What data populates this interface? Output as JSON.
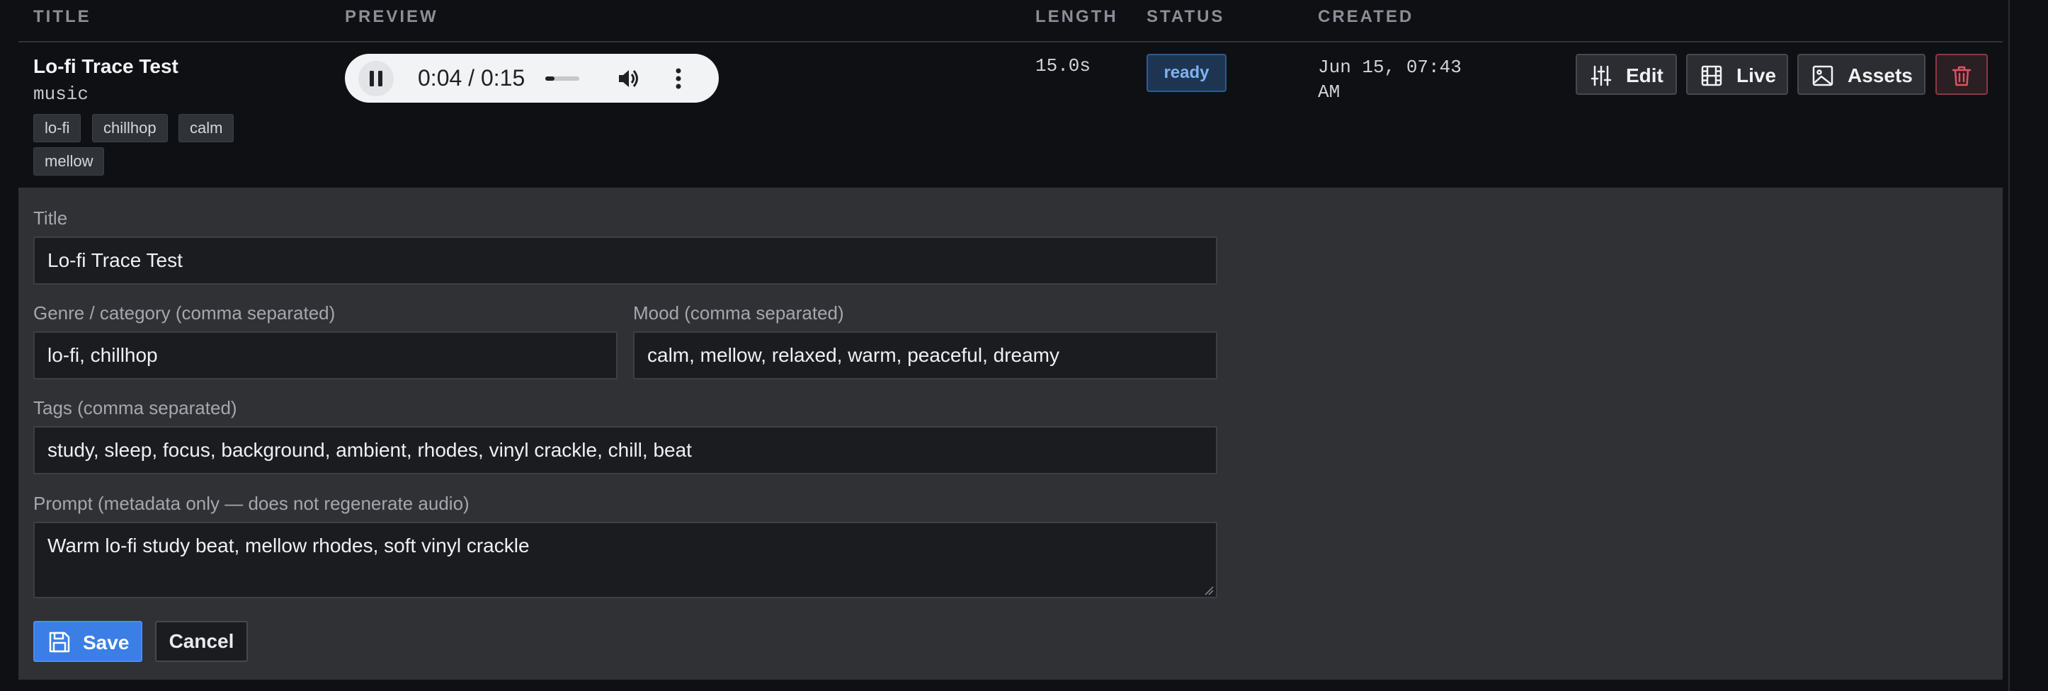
{
  "table": {
    "headers": {
      "title": "TITLE",
      "preview": "PREVIEW",
      "length": "LENGTH",
      "status": "STATUS",
      "created": "CREATED"
    }
  },
  "track": {
    "title": "Lo-fi Trace Test",
    "category": "music",
    "tags": [
      "lo-fi",
      "chillhop",
      "calm",
      "mellow"
    ],
    "length": "15.0s",
    "status": "ready",
    "created": "Jun 15, 07:43 AM"
  },
  "player": {
    "time": "0:04 / 0:15",
    "progress_fraction": 0.267,
    "icons": [
      "pause-icon",
      "volume-icon",
      "more-options-icon"
    ]
  },
  "actions": {
    "edit_label": "Edit",
    "live_label": "Live",
    "assets_label": "Assets",
    "icons": [
      "sliders-icon",
      "film-icon",
      "image-icon",
      "trash-icon"
    ]
  },
  "form": {
    "title_label": "Title",
    "title_value": "Lo-fi Trace Test",
    "genre_label": "Genre / category (comma separated)",
    "genre_value": "lo-fi, chillhop",
    "mood_label": "Mood (comma separated)",
    "mood_value": "calm, mellow, relaxed, warm, peaceful, dreamy",
    "tags_label": "Tags (comma separated)",
    "tags_value": "study, sleep, focus, background, ambient, rhodes, vinyl crackle, chill, beat",
    "prompt_label": "Prompt (metadata only — does not regenerate audio)",
    "prompt_value": "Warm lo-fi study beat, mellow rhodes, soft vinyl crackle",
    "save_label": "Save",
    "cancel_label": "Cancel"
  },
  "colors": {
    "background": "#0f1013",
    "panel": "#303135",
    "accent": "#3a7ee6",
    "status_ready": "#7fb2ef",
    "danger": "#e05261"
  }
}
